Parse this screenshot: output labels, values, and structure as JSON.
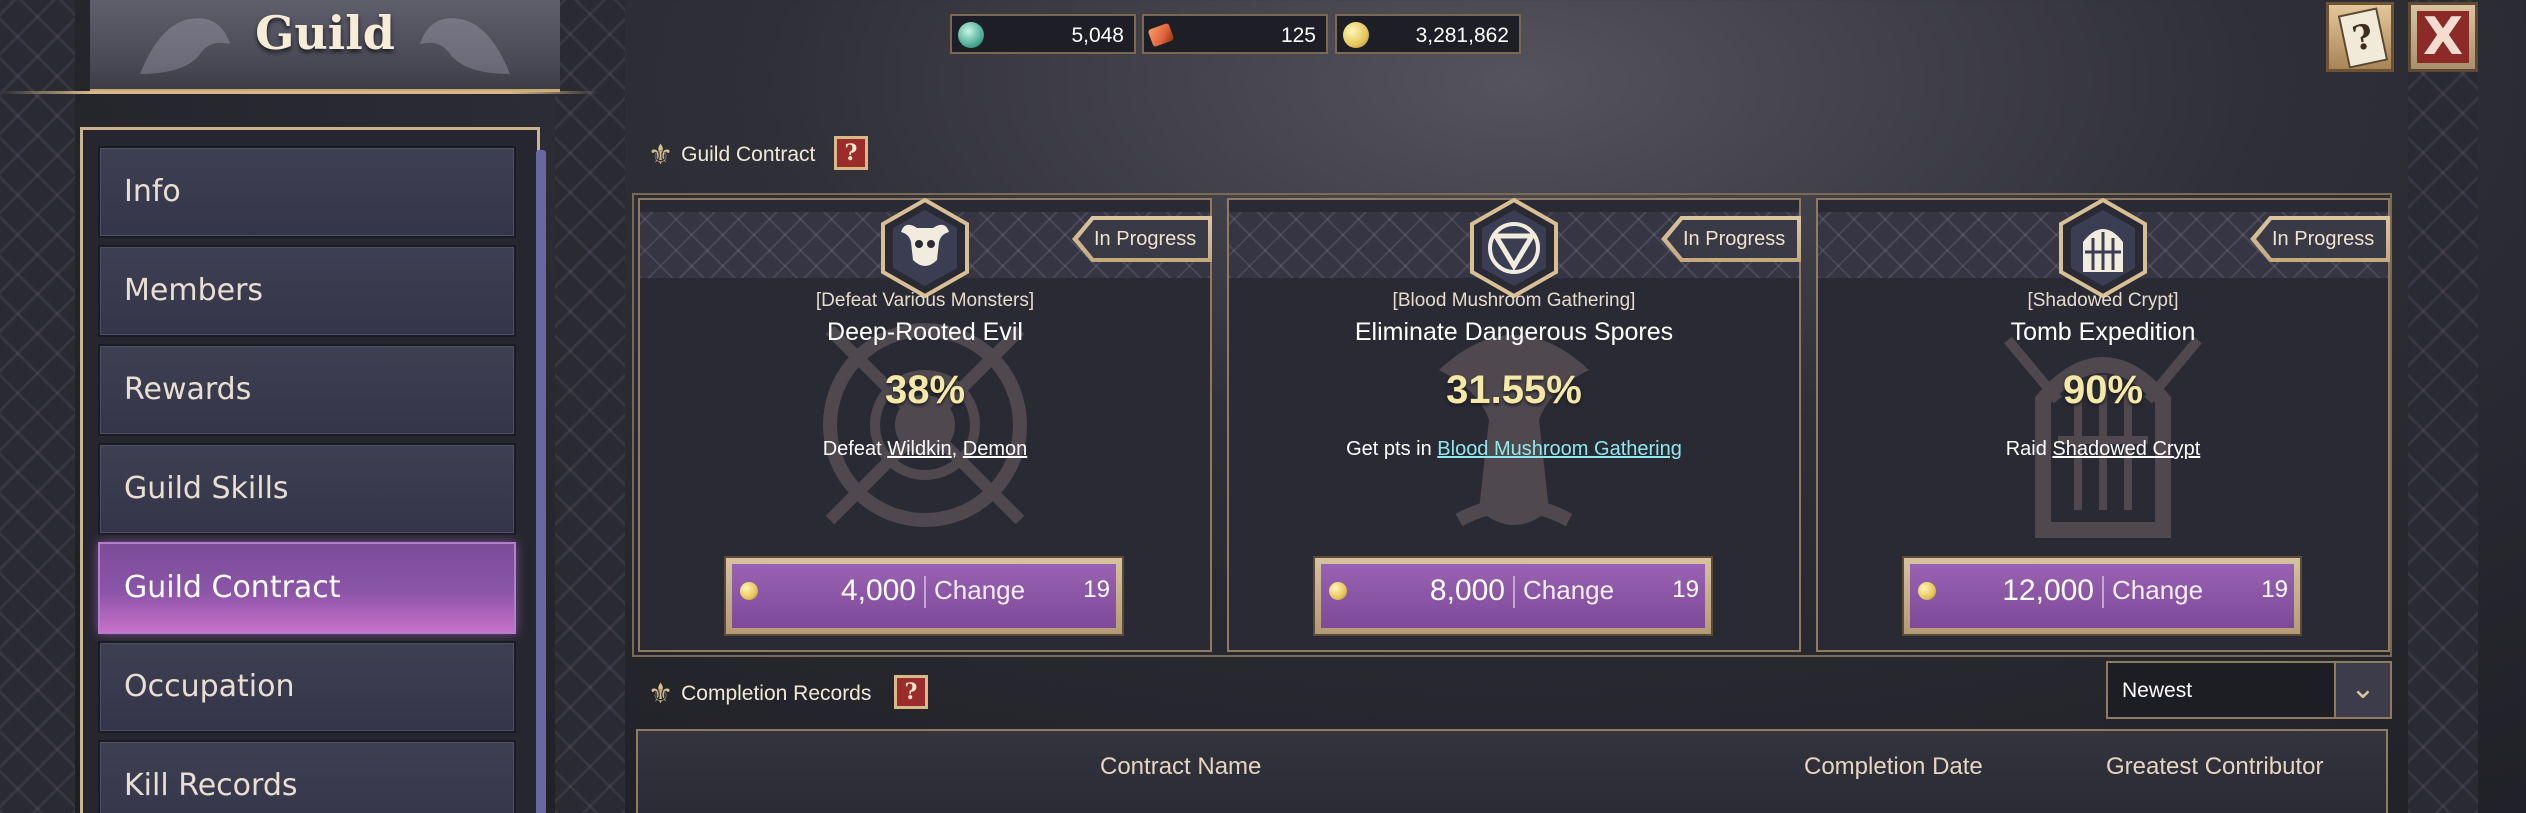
{
  "header": {
    "title": "Guild"
  },
  "currencies": [
    {
      "icon": "gem-icon",
      "color": "#4fae96",
      "value": "5,048"
    },
    {
      "icon": "ticket-icon",
      "color": "#e0643a",
      "value": "125"
    },
    {
      "icon": "gold-coin-icon",
      "color": "#e6c65a",
      "value": "3,281,862"
    }
  ],
  "top_buttons": {
    "book_glyph": "?",
    "close_glyph": "X"
  },
  "sidebar": {
    "items": [
      {
        "label": "Info"
      },
      {
        "label": "Members"
      },
      {
        "label": "Rewards"
      },
      {
        "label": "Guild Skills"
      },
      {
        "label": "Guild Contract",
        "active": true
      },
      {
        "label": "Occupation"
      },
      {
        "label": "Kill Records"
      }
    ]
  },
  "contract_section": {
    "title": "Guild Contract",
    "help": "?"
  },
  "contracts": [
    {
      "icon": "bull-skull-icon",
      "status": "In Progress",
      "category": "[Defeat Various Monsters]",
      "name": "Deep-Rooted Evil",
      "progress": "38%",
      "desc_prefix": "Defeat ",
      "desc_link1": "Wildkin",
      "desc_sep": ", ",
      "desc_link2": "Demon",
      "cost": "4,000",
      "change_label": "Change",
      "change_count": "19"
    },
    {
      "icon": "triangle-shield-icon",
      "status": "In Progress",
      "category": "[Blood Mushroom Gathering]",
      "name": "Eliminate Dangerous Spores",
      "progress": "31.55%",
      "desc_prefix": "Get pts in ",
      "desc_link1": "Blood Mushroom Gathering",
      "cost": "8,000",
      "change_label": "Change",
      "change_count": "19"
    },
    {
      "icon": "crypt-gate-icon",
      "status": "In Progress",
      "category": "[Shadowed Crypt]",
      "name": "Tomb Expedition",
      "progress": "90%",
      "desc_prefix": "Raid ",
      "desc_link1": "Shadowed Crypt",
      "cost": "12,000",
      "change_label": "Change",
      "change_count": "19"
    }
  ],
  "records_section": {
    "title": "Completion Records",
    "help": "?",
    "sort_value": "Newest",
    "columns": [
      "Contract Name",
      "Completion Date",
      "Greatest Contributor"
    ]
  }
}
